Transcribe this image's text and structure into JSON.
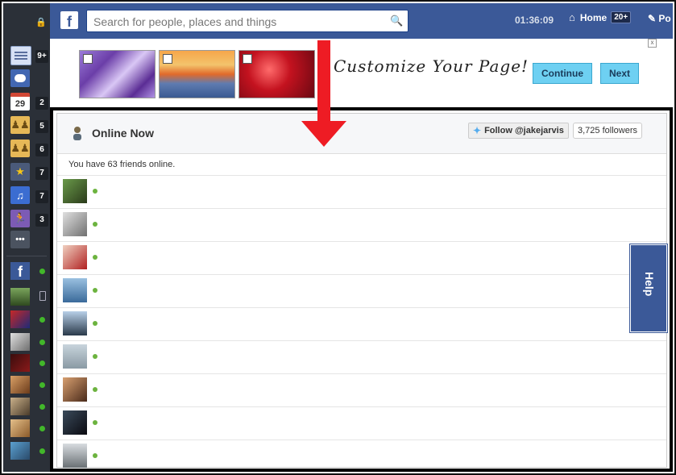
{
  "sidebar": {
    "items": [
      {
        "icon": "news-feed-icon",
        "count": "9+",
        "bg": "#d7e1f5"
      },
      {
        "icon": "messages-icon",
        "count": "",
        "bg": "#4267b2"
      },
      {
        "icon": "calendar-icon",
        "glyph": "29",
        "count": "2",
        "bg": "#e9ebee"
      },
      {
        "icon": "groups-icon",
        "count": "5",
        "bg": "#e6b857"
      },
      {
        "icon": "groups-icon",
        "count": "6",
        "bg": "#e6b857"
      },
      {
        "icon": "favorites-star-icon",
        "count": "7",
        "bg": "#4a5a7a"
      },
      {
        "icon": "music-icon",
        "count": "7",
        "bg": "#3b6dd1"
      },
      {
        "icon": "fitness-runner-icon",
        "count": "3",
        "bg": "#7c5bb5"
      },
      {
        "icon": "more-icon",
        "glyph": "•••",
        "count": "",
        "bg": "#4b5360"
      }
    ]
  },
  "topbar": {
    "logo": "f",
    "search_placeholder": "Search for people, places and things",
    "clock": "01:36:09",
    "home_label": "Home",
    "home_badge": "20+",
    "post_label": "Po"
  },
  "banner": {
    "title": "Customize Your Page!",
    "continue_label": "Continue",
    "next_label": "Next",
    "close": "x"
  },
  "panel": {
    "title": "Online Now",
    "follow_label": "Follow @jakejarvis",
    "followers": "3,725 followers",
    "friends_text": "You have 63 friends online.",
    "help_label": "Help"
  },
  "colors": {
    "fb_blue": "#3b5998",
    "online_green": "#42b72a",
    "arrow_red": "#ee1c24",
    "button_cyan": "#6ed0f2"
  }
}
